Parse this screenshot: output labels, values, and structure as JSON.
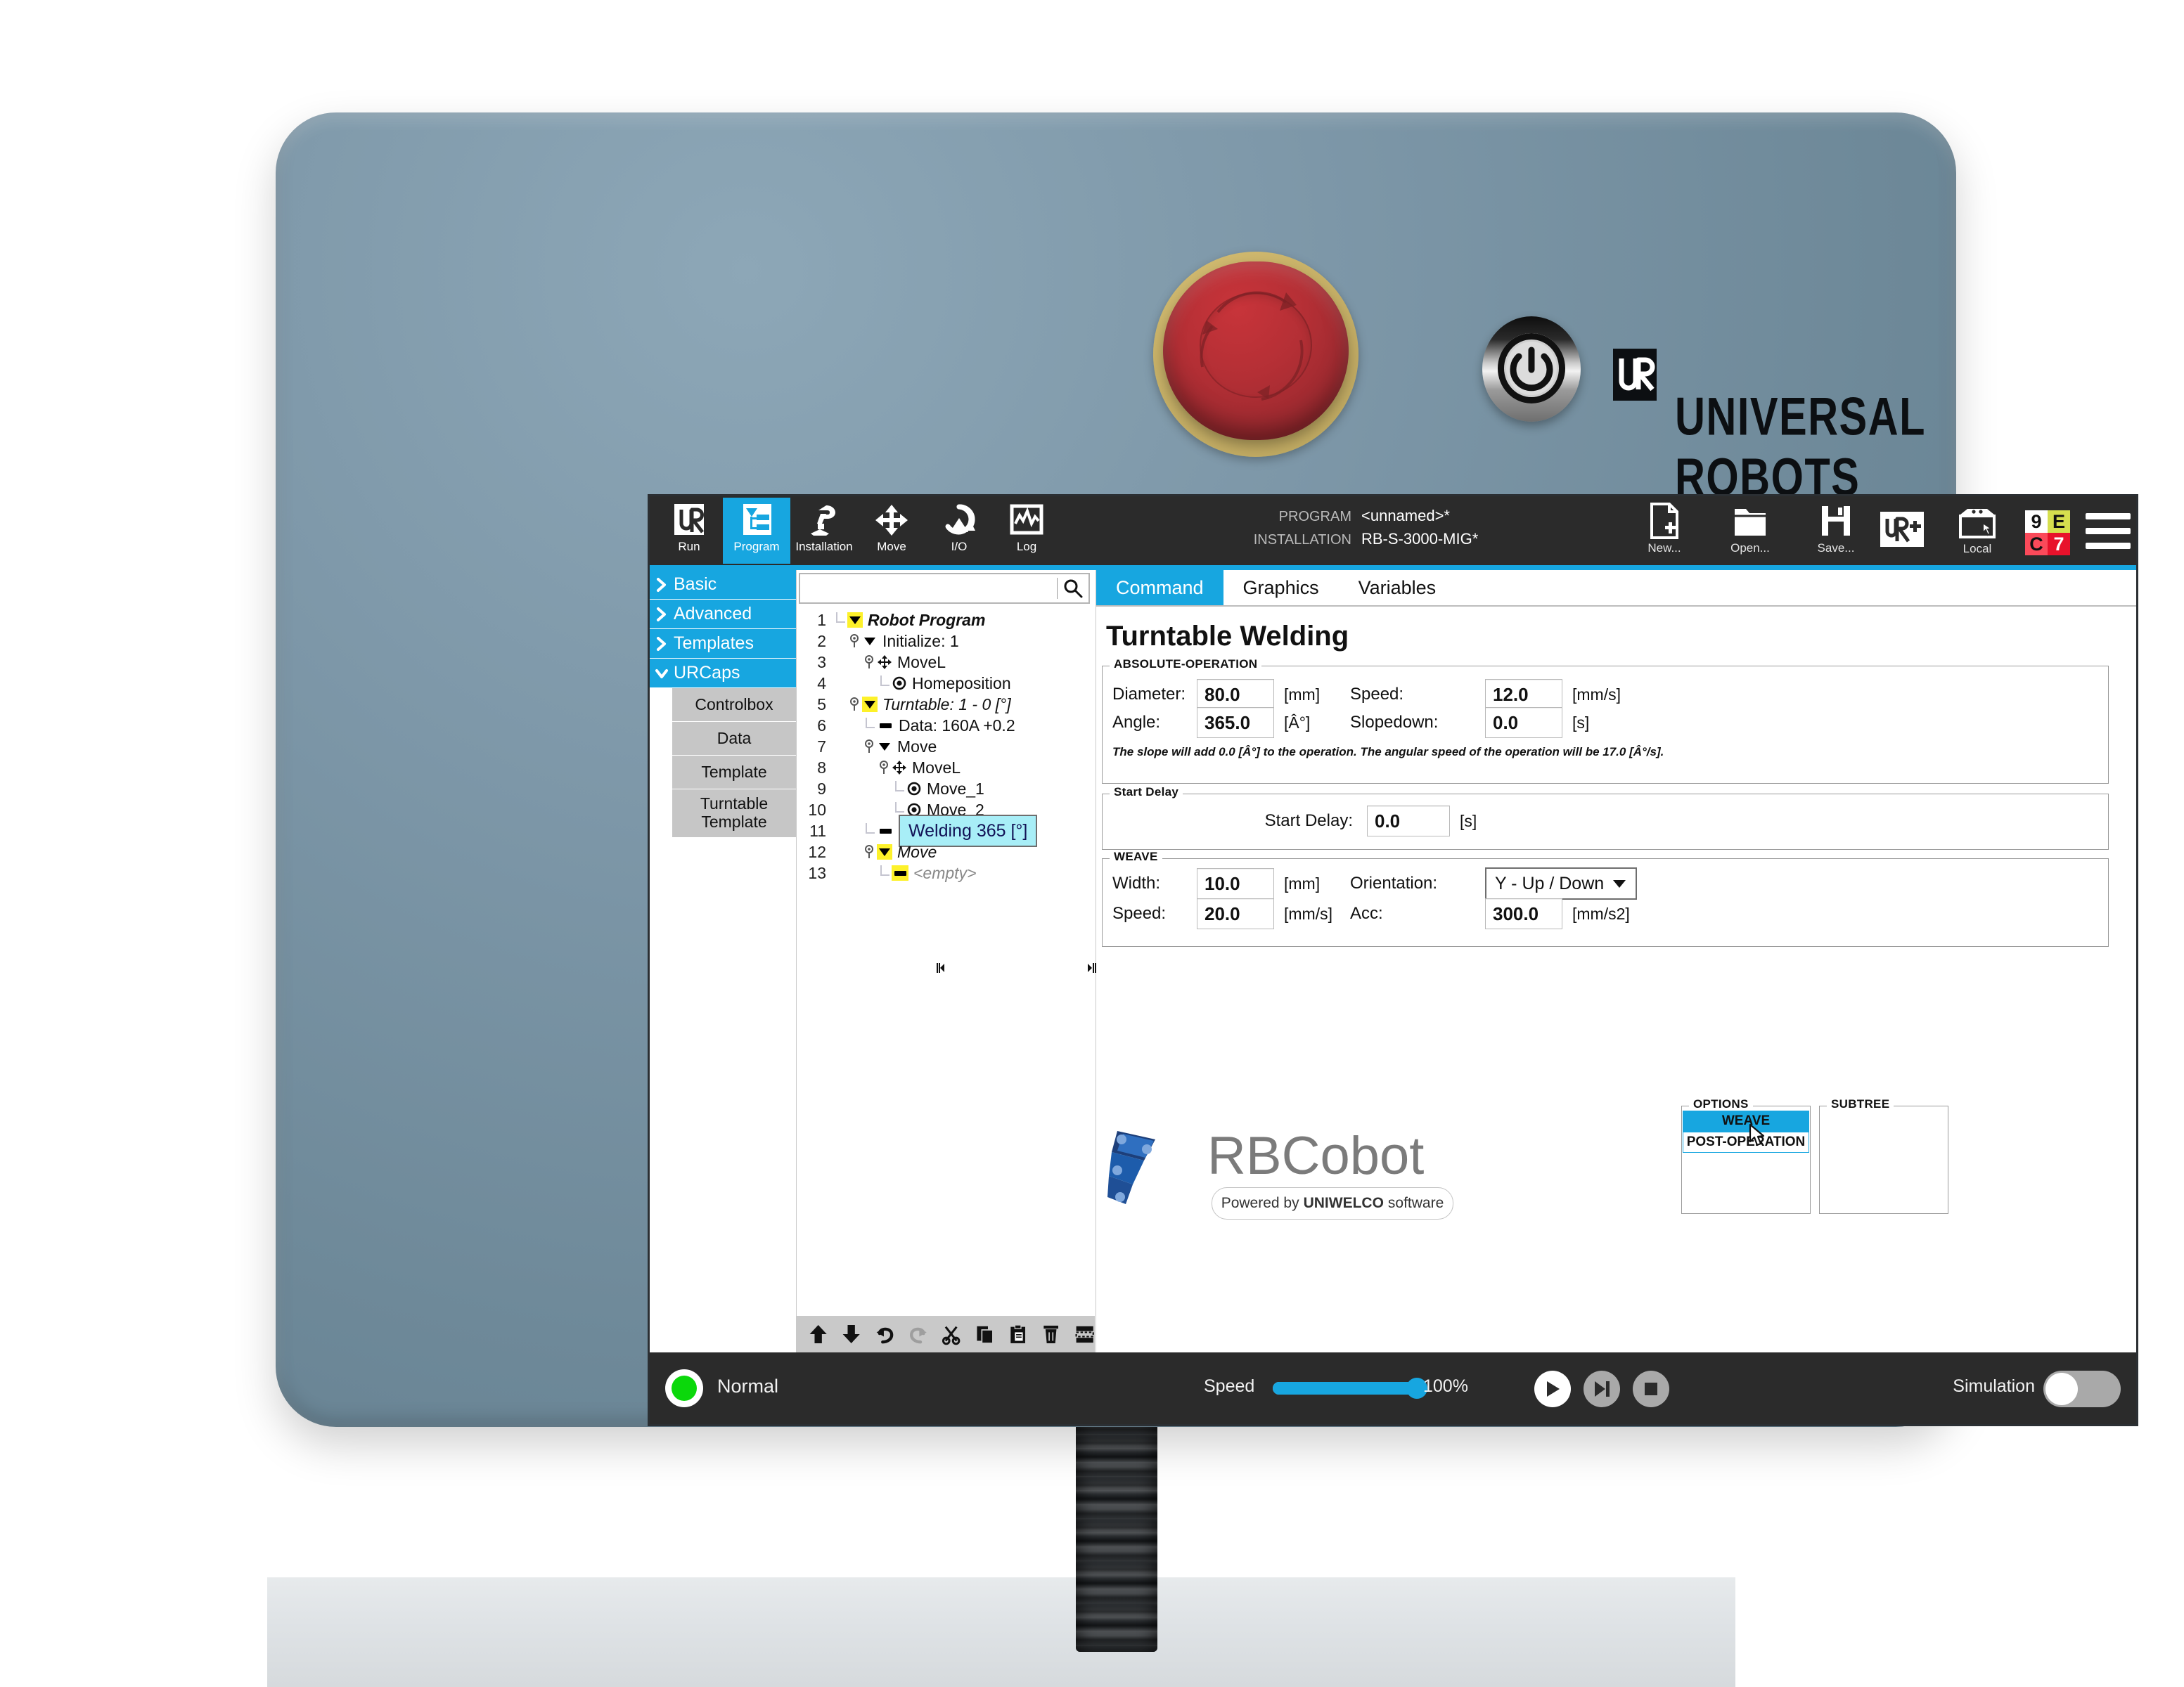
{
  "device": {
    "brand": "UNIVERSAL ROBOTS",
    "estop_name": "emergency-stop",
    "power_name": "power-button"
  },
  "topbar": {
    "tabs": [
      {
        "label": "Run",
        "icon": "ur-logo-icon",
        "active": false
      },
      {
        "label": "Program",
        "icon": "program-tree-icon",
        "active": true
      },
      {
        "label": "Installation",
        "icon": "robot-arm-icon",
        "active": false
      },
      {
        "label": "Move",
        "icon": "move-arrows-icon",
        "active": false
      },
      {
        "label": "I/O",
        "icon": "io-loop-icon",
        "active": false
      },
      {
        "label": "Log",
        "icon": "waveform-icon",
        "active": false
      }
    ],
    "program_key": "PROGRAM",
    "program_value": "<unnamed>*",
    "installation_key": "INSTALLATION",
    "installation_value": "RB-S-3000-MIG*",
    "file_actions": [
      {
        "label": "New...",
        "icon": "new-file-icon"
      },
      {
        "label": "Open...",
        "icon": "open-folder-icon"
      },
      {
        "label": "Save...",
        "icon": "save-floppy-icon"
      }
    ],
    "urplus_label": "UR+",
    "local_label": "Local",
    "safety_badge": {
      "tl": "9",
      "tr": "E",
      "bl": "C",
      "br": "7"
    },
    "accent_color": "#17a6e0"
  },
  "sidebar": {
    "categories": [
      {
        "label": "Basic",
        "expanded": false
      },
      {
        "label": "Advanced",
        "expanded": false
      },
      {
        "label": "Templates",
        "expanded": false
      },
      {
        "label": "URCaps",
        "expanded": true
      }
    ],
    "urcaps_items": [
      "Controlbox",
      "Data",
      "Template",
      "Turntable Template"
    ]
  },
  "search": {
    "value": "",
    "placeholder": ""
  },
  "tree": {
    "rows": [
      {
        "num": "1",
        "indent": 0,
        "pin": false,
        "marker": "triangle",
        "marker_color": "yellow",
        "label": "Robot Program",
        "style": "bold-italic",
        "selected": false
      },
      {
        "num": "2",
        "indent": 1,
        "pin": true,
        "marker": "triangle",
        "marker_color": "plain",
        "label": "Initialize: 1",
        "style": "normal",
        "selected": false
      },
      {
        "num": "3",
        "indent": 2,
        "pin": true,
        "marker": "movel",
        "marker_color": "plain",
        "label": "MoveL",
        "style": "normal",
        "selected": false
      },
      {
        "num": "4",
        "indent": 3,
        "pin": false,
        "marker": "waypoint",
        "marker_color": "plain",
        "label": "Homeposition",
        "style": "normal",
        "selected": false
      },
      {
        "num": "5",
        "indent": 1,
        "pin": true,
        "marker": "triangle",
        "marker_color": "yellow",
        "label": "Turntable: 1 - 0 [°]",
        "style": "italic",
        "selected": false
      },
      {
        "num": "6",
        "indent": 2,
        "pin": false,
        "marker": "dash",
        "marker_color": "plain",
        "label": "Data: 160A +0.2",
        "style": "normal",
        "selected": false
      },
      {
        "num": "7",
        "indent": 2,
        "pin": true,
        "marker": "triangle",
        "marker_color": "plain",
        "label": "Move",
        "style": "normal",
        "selected": false
      },
      {
        "num": "8",
        "indent": 3,
        "pin": true,
        "marker": "movel",
        "marker_color": "plain",
        "label": "MoveL",
        "style": "normal",
        "selected": false
      },
      {
        "num": "9",
        "indent": 4,
        "pin": false,
        "marker": "waypoint",
        "marker_color": "plain",
        "label": "Move_1",
        "style": "normal",
        "selected": false
      },
      {
        "num": "10",
        "indent": 4,
        "pin": false,
        "marker": "waypoint",
        "marker_color": "plain",
        "label": "Move_2",
        "style": "normal",
        "selected": false
      },
      {
        "num": "11",
        "indent": 2,
        "pin": false,
        "marker": "dash",
        "marker_color": "plain",
        "label": "Welding 365 [°]",
        "style": "normal",
        "selected": true
      },
      {
        "num": "12",
        "indent": 2,
        "pin": true,
        "marker": "triangle",
        "marker_color": "yellow",
        "label": "Move",
        "style": "italic",
        "selected": false
      },
      {
        "num": "13",
        "indent": 3,
        "pin": false,
        "marker": "dash",
        "marker_color": "yellow",
        "label": "<empty>",
        "style": "empty",
        "selected": false
      }
    ],
    "tools": [
      {
        "name": "move-up-icon"
      },
      {
        "name": "move-down-icon"
      },
      {
        "name": "undo-icon"
      },
      {
        "name": "redo-icon"
      },
      {
        "name": "cut-icon"
      },
      {
        "name": "copy-icon"
      },
      {
        "name": "paste-icon"
      },
      {
        "name": "delete-icon"
      },
      {
        "name": "suppress-icon"
      }
    ]
  },
  "content": {
    "tabs": [
      {
        "label": "Command",
        "active": true
      },
      {
        "label": "Graphics",
        "active": false
      },
      {
        "label": "Variables",
        "active": false
      }
    ],
    "title": "Turntable Welding",
    "absolute_operation": {
      "legend": "ABSOLUTE-OPERATION",
      "fields": [
        {
          "label": "Diameter:",
          "value": "80.0",
          "unit": "[mm]"
        },
        {
          "label": "Speed:",
          "value": "12.0",
          "unit": "[mm/s]"
        },
        {
          "label": "Angle:",
          "value": "365.0",
          "unit": "[Â°]"
        },
        {
          "label": "Slopedown:",
          "value": "0.0",
          "unit": "[s]"
        }
      ],
      "note": "The slope will add 0.0 [Â°] to the operation. The angular speed of the operation will be 17.0 [Â°/s]."
    },
    "start_delay": {
      "legend": "Start Delay",
      "label": "Start Delay:",
      "value": "0.0",
      "unit": "[s]"
    },
    "weave": {
      "legend": "WEAVE",
      "width_label": "Width:",
      "width_value": "10.0",
      "width_unit": "[mm]",
      "orientation_label": "Orientation:",
      "orientation_value": "Y - Up / Down",
      "speed_label": "Speed:",
      "speed_value": "20.0",
      "speed_unit": "[mm/s]",
      "acc_label": "Acc:",
      "acc_value": "300.0",
      "acc_unit": "[mm/s2]"
    },
    "logo": {
      "name": "RBCobot",
      "tagline_pre": "Powered by",
      "tagline_brand": "UNIWELCO",
      "tagline_post": "software"
    },
    "options": {
      "legend": "OPTIONS",
      "items": [
        {
          "label": "WEAVE",
          "selected": true
        },
        {
          "label": "POST-OPERATION",
          "selected": false
        }
      ]
    },
    "subtree": {
      "legend": "SUBTREE",
      "items": []
    }
  },
  "statusbar": {
    "robot_state": "Normal",
    "state_color": "#0bd80b",
    "speed_label": "Speed",
    "speed_value": "100%",
    "speed_percent": 100,
    "buttons": [
      {
        "name": "play-button",
        "icon": "play-icon"
      },
      {
        "name": "step-button",
        "icon": "step-icon"
      },
      {
        "name": "stop-button",
        "icon": "stop-icon"
      }
    ],
    "simulation_label": "Simulation",
    "simulation_on": false
  }
}
